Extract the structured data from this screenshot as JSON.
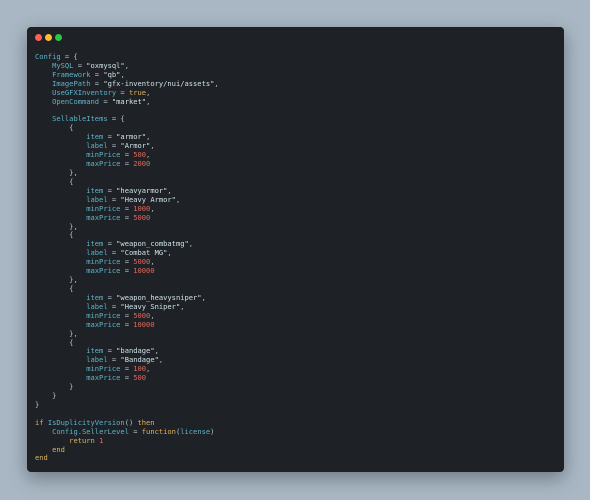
{
  "window": {
    "colors": {
      "close": "#ff5f57",
      "minimize": "#febc2e",
      "maximize": "#28c840"
    }
  },
  "token_colors": {
    "id": "#5fb4c8",
    "kw": "#e0b25a",
    "str": "#cfe3ea",
    "num": "#e3685c",
    "bool": "#e0b25a",
    "punct": "#b7c4cc",
    "ws": "#5fb4c8"
  },
  "code_lines": [
    [
      [
        "id",
        "Config"
      ],
      [
        "punct",
        " = {"
      ]
    ],
    [
      [
        "ws",
        "    "
      ],
      [
        "id",
        "MySQL"
      ],
      [
        "punct",
        " = "
      ],
      [
        "str",
        "\"oxmysql\""
      ],
      [
        "punct",
        ","
      ]
    ],
    [
      [
        "ws",
        "    "
      ],
      [
        "id",
        "Framework"
      ],
      [
        "punct",
        " = "
      ],
      [
        "str",
        "\"qb\""
      ],
      [
        "punct",
        ","
      ]
    ],
    [
      [
        "ws",
        "    "
      ],
      [
        "id",
        "ImagePath"
      ],
      [
        "punct",
        " = "
      ],
      [
        "str",
        "\"gfx-inventory/nui/assets\""
      ],
      [
        "punct",
        ","
      ]
    ],
    [
      [
        "ws",
        "    "
      ],
      [
        "id",
        "UseGFXInventory"
      ],
      [
        "punct",
        " = "
      ],
      [
        "bool",
        "true"
      ],
      [
        "punct",
        ","
      ]
    ],
    [
      [
        "ws",
        "    "
      ],
      [
        "id",
        "OpenCommand"
      ],
      [
        "punct",
        " = "
      ],
      [
        "str",
        "\"market\""
      ],
      [
        "punct",
        ","
      ]
    ],
    [],
    [
      [
        "ws",
        "    "
      ],
      [
        "id",
        "SellableItems"
      ],
      [
        "punct",
        " = {"
      ]
    ],
    [
      [
        "ws",
        "        "
      ],
      [
        "punct",
        "{"
      ]
    ],
    [
      [
        "ws",
        "            "
      ],
      [
        "id",
        "item"
      ],
      [
        "punct",
        " = "
      ],
      [
        "str",
        "\"armor\""
      ],
      [
        "punct",
        ","
      ]
    ],
    [
      [
        "ws",
        "            "
      ],
      [
        "id",
        "label"
      ],
      [
        "punct",
        " = "
      ],
      [
        "str",
        "\"Armor\""
      ],
      [
        "punct",
        ","
      ]
    ],
    [
      [
        "ws",
        "            "
      ],
      [
        "id",
        "minPrice"
      ],
      [
        "punct",
        " = "
      ],
      [
        "num",
        "500"
      ],
      [
        "punct",
        ","
      ]
    ],
    [
      [
        "ws",
        "            "
      ],
      [
        "id",
        "maxPrice"
      ],
      [
        "punct",
        " = "
      ],
      [
        "num",
        "2000"
      ]
    ],
    [
      [
        "ws",
        "        "
      ],
      [
        "punct",
        "},"
      ]
    ],
    [
      [
        "ws",
        "        "
      ],
      [
        "punct",
        "{"
      ]
    ],
    [
      [
        "ws",
        "            "
      ],
      [
        "id",
        "item"
      ],
      [
        "punct",
        " = "
      ],
      [
        "str",
        "\"heavyarmor\""
      ],
      [
        "punct",
        ","
      ]
    ],
    [
      [
        "ws",
        "            "
      ],
      [
        "id",
        "label"
      ],
      [
        "punct",
        " = "
      ],
      [
        "str",
        "\"Heavy Armor\""
      ],
      [
        "punct",
        ","
      ]
    ],
    [
      [
        "ws",
        "            "
      ],
      [
        "id",
        "minPrice"
      ],
      [
        "punct",
        " = "
      ],
      [
        "num",
        "1000"
      ],
      [
        "punct",
        ","
      ]
    ],
    [
      [
        "ws",
        "            "
      ],
      [
        "id",
        "maxPrice"
      ],
      [
        "punct",
        " = "
      ],
      [
        "num",
        "5000"
      ]
    ],
    [
      [
        "ws",
        "        "
      ],
      [
        "punct",
        "},"
      ]
    ],
    [
      [
        "ws",
        "        "
      ],
      [
        "punct",
        "{"
      ]
    ],
    [
      [
        "ws",
        "            "
      ],
      [
        "id",
        "item"
      ],
      [
        "punct",
        " = "
      ],
      [
        "str",
        "\"weapon_combatmg\""
      ],
      [
        "punct",
        ","
      ]
    ],
    [
      [
        "ws",
        "            "
      ],
      [
        "id",
        "label"
      ],
      [
        "punct",
        " = "
      ],
      [
        "str",
        "\"Combat MG\""
      ],
      [
        "punct",
        ","
      ]
    ],
    [
      [
        "ws",
        "            "
      ],
      [
        "id",
        "minPrice"
      ],
      [
        "punct",
        " = "
      ],
      [
        "num",
        "5000"
      ],
      [
        "punct",
        ","
      ]
    ],
    [
      [
        "ws",
        "            "
      ],
      [
        "id",
        "maxPrice"
      ],
      [
        "punct",
        " = "
      ],
      [
        "num",
        "10000"
      ]
    ],
    [
      [
        "ws",
        "        "
      ],
      [
        "punct",
        "},"
      ]
    ],
    [
      [
        "ws",
        "        "
      ],
      [
        "punct",
        "{"
      ]
    ],
    [
      [
        "ws",
        "            "
      ],
      [
        "id",
        "item"
      ],
      [
        "punct",
        " = "
      ],
      [
        "str",
        "\"weapon_heavysniper\""
      ],
      [
        "punct",
        ","
      ]
    ],
    [
      [
        "ws",
        "            "
      ],
      [
        "id",
        "label"
      ],
      [
        "punct",
        " = "
      ],
      [
        "str",
        "\"Heavy Sniper\""
      ],
      [
        "punct",
        ","
      ]
    ],
    [
      [
        "ws",
        "            "
      ],
      [
        "id",
        "minPrice"
      ],
      [
        "punct",
        " = "
      ],
      [
        "num",
        "5000"
      ],
      [
        "punct",
        ","
      ]
    ],
    [
      [
        "ws",
        "            "
      ],
      [
        "id",
        "maxPrice"
      ],
      [
        "punct",
        " = "
      ],
      [
        "num",
        "10000"
      ]
    ],
    [
      [
        "ws",
        "        "
      ],
      [
        "punct",
        "},"
      ]
    ],
    [
      [
        "ws",
        "        "
      ],
      [
        "punct",
        "{"
      ]
    ],
    [
      [
        "ws",
        "            "
      ],
      [
        "id",
        "item"
      ],
      [
        "punct",
        " = "
      ],
      [
        "str",
        "\"bandage\""
      ],
      [
        "punct",
        ","
      ]
    ],
    [
      [
        "ws",
        "            "
      ],
      [
        "id",
        "label"
      ],
      [
        "punct",
        " = "
      ],
      [
        "str",
        "\"Bandage\""
      ],
      [
        "punct",
        ","
      ]
    ],
    [
      [
        "ws",
        "            "
      ],
      [
        "id",
        "minPrice"
      ],
      [
        "punct",
        " = "
      ],
      [
        "num",
        "100"
      ],
      [
        "punct",
        ","
      ]
    ],
    [
      [
        "ws",
        "            "
      ],
      [
        "id",
        "maxPrice"
      ],
      [
        "punct",
        " = "
      ],
      [
        "num",
        "500"
      ]
    ],
    [
      [
        "ws",
        "        "
      ],
      [
        "punct",
        "}"
      ]
    ],
    [
      [
        "ws",
        "    "
      ],
      [
        "punct",
        "}"
      ]
    ],
    [
      [
        "punct",
        "}"
      ]
    ],
    [],
    [
      [
        "kw",
        "if "
      ],
      [
        "id",
        "IsDuplicityVersion"
      ],
      [
        "punct",
        "() "
      ],
      [
        "kw",
        "then"
      ]
    ],
    [
      [
        "ws",
        "    "
      ],
      [
        "id",
        "Config.SellerLevel"
      ],
      [
        "punct",
        " = "
      ],
      [
        "kw",
        "function"
      ],
      [
        "punct",
        "("
      ],
      [
        "id",
        "license"
      ],
      [
        "punct",
        ")"
      ]
    ],
    [
      [
        "ws",
        "        "
      ],
      [
        "kw",
        "return "
      ],
      [
        "num",
        "1"
      ]
    ],
    [
      [
        "ws",
        "    "
      ],
      [
        "kw",
        "end"
      ]
    ],
    [
      [
        "kw",
        "end"
      ]
    ]
  ]
}
